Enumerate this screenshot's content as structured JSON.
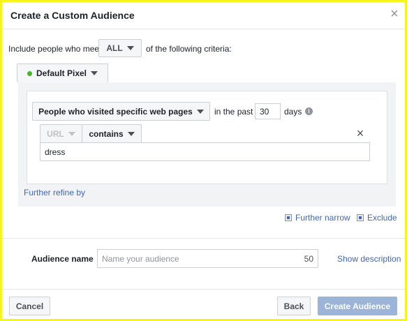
{
  "dialog": {
    "title": "Create a Custom Audience",
    "close_glyph": "×"
  },
  "criteria": {
    "include_prefix": "Include people who meet",
    "match_value": "ALL",
    "include_suffix": "of the following criteria:"
  },
  "pixel": {
    "label": "Default Pixel",
    "status_color": "#42b72a"
  },
  "rule": {
    "visitor_type": "People who visited specific web pages",
    "in_the_past_label": "in the past",
    "days_value": "30",
    "days_label": "days",
    "info_glyph": "i"
  },
  "filter": {
    "field": "URL",
    "operator": "contains",
    "value": "dress",
    "remove_glyph": "×"
  },
  "refine": {
    "further_refine": "Further refine by",
    "further_narrow": "Further narrow",
    "exclude": "Exclude"
  },
  "audience_name": {
    "label": "Audience name",
    "placeholder": "Name your audience",
    "char_limit": "50",
    "show_description": "Show description"
  },
  "footer": {
    "cancel": "Cancel",
    "back": "Back",
    "create": "Create Audience",
    "create_color": "#9cb4d8"
  },
  "icons": {
    "close": "close-icon",
    "caret": "chevron-down-icon",
    "info": "info-icon",
    "pixel_status": "status-dot-icon",
    "narrow": "narrow-icon",
    "exclude": "exclude-icon"
  }
}
